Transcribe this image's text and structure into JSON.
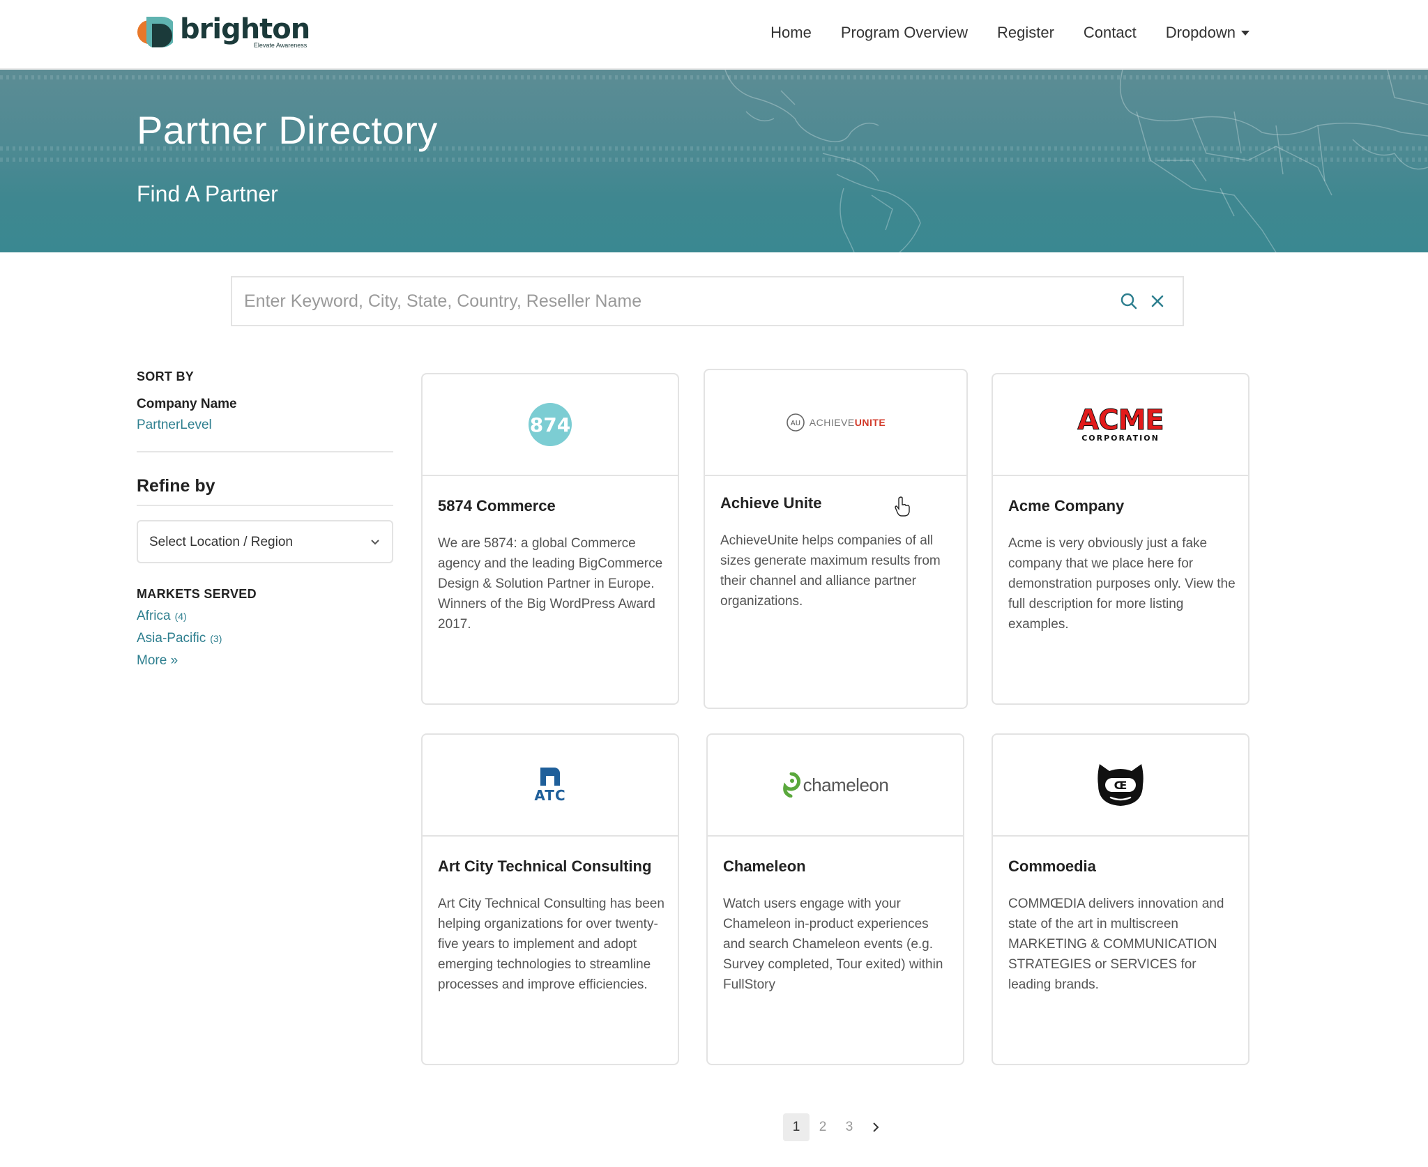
{
  "brand": {
    "name": "brighton",
    "tagline": "Elevate Awareness",
    "colors": {
      "teal": "#3a8891",
      "orange": "#e8782a",
      "dark": "#1b3a3a",
      "link": "#2e7f8f"
    }
  },
  "nav": {
    "items": [
      "Home",
      "Program Overview",
      "Register",
      "Contact"
    ],
    "dropdown_label": "Dropdown"
  },
  "hero": {
    "title": "Partner Directory",
    "subtitle": "Find A Partner"
  },
  "search": {
    "placeholder": "Enter Keyword, City, State, Country, Reseller Name",
    "value": "",
    "search_icon": "search-icon",
    "clear_icon": "close-icon"
  },
  "sidebar": {
    "sort_heading": "SORT BY",
    "sort_options": [
      "Company Name",
      "PartnerLevel"
    ],
    "sort_active": "Company Name",
    "refine_heading": "Refine by",
    "location_select": "Select Location / Region",
    "markets_heading": "MARKETS SERVED",
    "markets": [
      {
        "name": "Africa",
        "count": "(4)"
      },
      {
        "name": "Asia-Pacific",
        "count": "(3)"
      }
    ],
    "more_label": "More »"
  },
  "partners": [
    {
      "name": "5874 Commerce",
      "logo_text": "874",
      "description": "We are 5874: a global Commerce agency and the leading BigCommerce Design & Solution Partner in Europe. Winners of the Big WordPress Award 2017."
    },
    {
      "name": "Achieve Unite",
      "logo_text": "AU",
      "logo_word_a": "ACHIEVE",
      "logo_word_b": "UNITE",
      "description": "AchieveUnite helps companies of all sizes generate maximum results from their channel and alliance partner organizations."
    },
    {
      "name": "Acme Company",
      "logo_text": "ACME",
      "logo_subtext": "CORPORATION",
      "description": "Acme is very obviously just a fake company that we place here for demonstration purposes only. View the full description for more listing examples."
    },
    {
      "name": "Art City Technical Consulting",
      "logo_text": "ATC",
      "description": "Art City Technical Consulting has been helping organizations for over twenty-five years to implement and adopt emerging technologies to streamline processes and improve efficiencies."
    },
    {
      "name": "Chameleon",
      "logo_text": "chameleon",
      "description": "Watch users engage with your Chameleon in-product experiences and search Chameleon events (e.g. Survey completed, Tour exited) within FullStory"
    },
    {
      "name": "Commoedia",
      "logo_text": "Œ",
      "description": "COMMŒDIA delivers innovation and state of the art in multiscreen MARKETING & COMMUNICATION STRATEGIES or SERVICES for leading brands."
    }
  ],
  "pagination": {
    "pages": [
      "1",
      "2",
      "3"
    ],
    "current": "1",
    "next_icon": "chevron-right-icon"
  }
}
